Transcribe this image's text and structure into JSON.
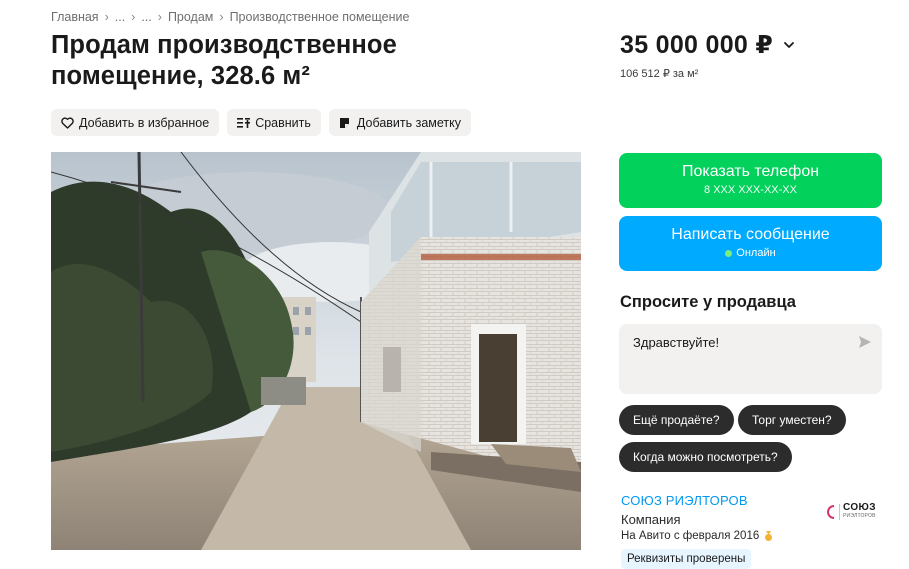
{
  "breadcrumb": [
    "Главная",
    "...",
    "...",
    "Продам",
    "Производственное помещение"
  ],
  "title": "Продам производственное помещение, 328.6 м²",
  "actions": {
    "favorite": "Добавить в избранное",
    "compare": "Сравнить",
    "note": "Добавить заметку"
  },
  "price": {
    "value": "35 000 000 ₽",
    "per_m": "106 512 ₽ за м²"
  },
  "contact": {
    "phone_label": "Показать телефон",
    "phone_masked": "8 XXX XXX-XX-XX",
    "message_label": "Написать сообщение",
    "status": "Онлайн"
  },
  "ask": {
    "title": "Спросите у продавца",
    "message_value": "Здравствуйте!",
    "quick_replies": [
      "Ещё продаёте?",
      "Торг уместен?",
      "Когда можно посмотреть?"
    ]
  },
  "seller": {
    "name": "СОЮЗ РИЭЛТОРОВ",
    "type": "Компания",
    "since": "На Авито с февраля 2016",
    "verified": "Реквизиты проверены",
    "logo_text": "СОЮЗ",
    "logo_subtext": "РИЭЛТОРОВ"
  },
  "colors": {
    "phone_button": "#02d15c",
    "message_button": "#00aaff",
    "seller_link": "#0099ef",
    "chip": "#2c2c2c"
  },
  "icons": {
    "favorite": "heart-icon",
    "compare": "compare-icon",
    "note": "note-icon",
    "send": "send-icon",
    "medal": "medal-icon"
  }
}
